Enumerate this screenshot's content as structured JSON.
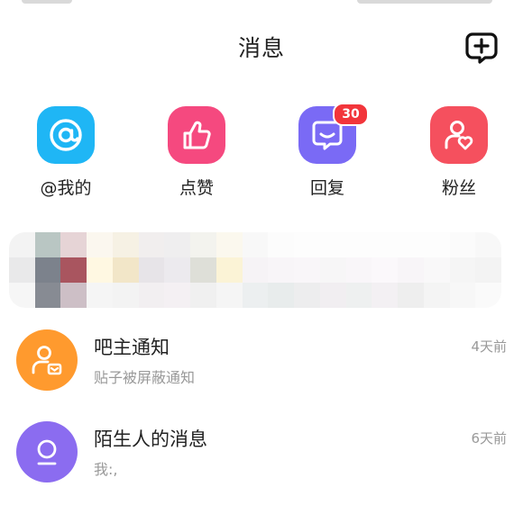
{
  "header": {
    "title": "消息"
  },
  "categories": [
    {
      "label": "@我的",
      "icon": "at-icon",
      "color": "#1fb6f5"
    },
    {
      "label": "点赞",
      "icon": "thumbs-up-icon",
      "color": "#f5497f"
    },
    {
      "label": "回复",
      "icon": "reply-chat-icon",
      "color": "#7a6af5",
      "badge": "30"
    },
    {
      "label": "粉丝",
      "icon": "fan-user-heart-icon",
      "color": "#f5505e"
    }
  ],
  "messages": [
    {
      "title": "吧主通知",
      "subtitle": "贴子被屏蔽通知",
      "time": "4天前",
      "icon": "admin-user-icon",
      "color": "#ff9a2e"
    },
    {
      "title": "陌生人的消息",
      "subtitle": "我:,",
      "time": "6天前",
      "icon": "person-icon",
      "color": "#8b6cf0"
    }
  ],
  "colors": {
    "badge": "#f2353b",
    "text_primary": "#222222",
    "text_secondary": "#999999"
  }
}
